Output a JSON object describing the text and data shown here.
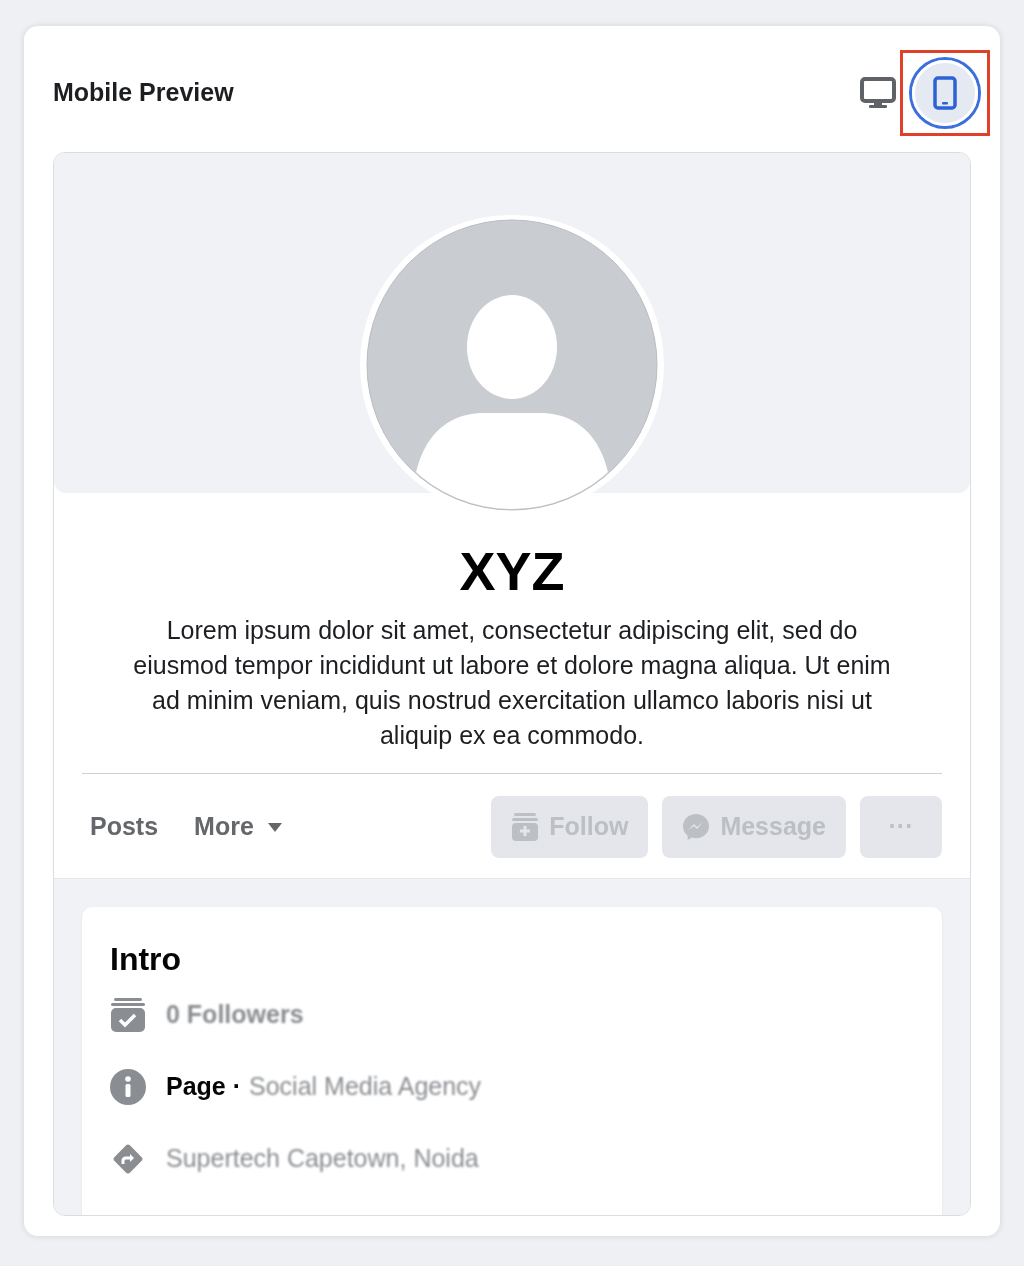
{
  "header": {
    "title": "Mobile Preview"
  },
  "view_toggles": [
    {
      "kind": "desktop",
      "selected": false
    },
    {
      "kind": "mobile",
      "selected": true,
      "highlighted": true
    }
  ],
  "profile": {
    "name": "XYZ",
    "description": "Lorem ipsum dolor sit amet, consectetur adipiscing elit, sed do eiusmod tempor incididunt ut labore et dolore magna aliqua. Ut enim ad minim veniam, quis nostrud exercitation ullamco laboris nisi ut aliquip ex ea commodo."
  },
  "tabs": [
    {
      "label": "Posts",
      "kind": "plain"
    },
    {
      "label": "More",
      "kind": "dropdown"
    }
  ],
  "actions": [
    {
      "label": "Follow",
      "kind": "follow",
      "disabled": true
    },
    {
      "label": "Message",
      "kind": "message",
      "disabled": true
    },
    {
      "label": "···",
      "kind": "more",
      "disabled": true
    }
  ],
  "intro": {
    "title": "Intro",
    "items": [
      {
        "kind": "followers",
        "value": "0 Followers"
      },
      {
        "kind": "page",
        "label": "Page ·",
        "value": "Social Media Agency"
      },
      {
        "kind": "address",
        "value": "Supertech Capetown, Noida"
      }
    ]
  }
}
